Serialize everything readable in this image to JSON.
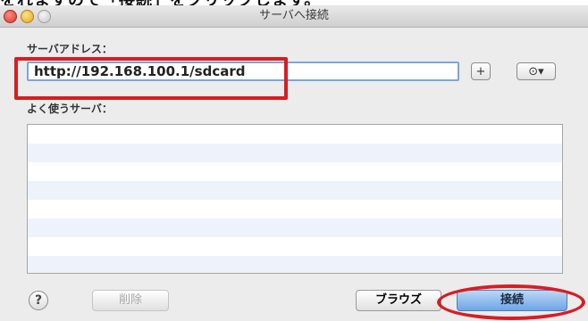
{
  "caption": "をれますので「接続」をクリックします。",
  "window": {
    "title": "サーバへ接続"
  },
  "form": {
    "server_address_label": "サーバアドレス：",
    "server_address_value": "http://192.168.100.1/sdcard",
    "add_label": "+",
    "recent_menu_label": "⊙▾",
    "favorites_label": "よく使うサーバ："
  },
  "favorites": {
    "items": []
  },
  "footer": {
    "help_label": "?",
    "delete_label": "削除",
    "browse_label": "ブラウズ",
    "connect_label": "接続"
  },
  "colors": {
    "annotation_red": "#d81d23",
    "input_focus_blue": "#7aa7da",
    "primary_button_blue": "#6ea5e6"
  }
}
